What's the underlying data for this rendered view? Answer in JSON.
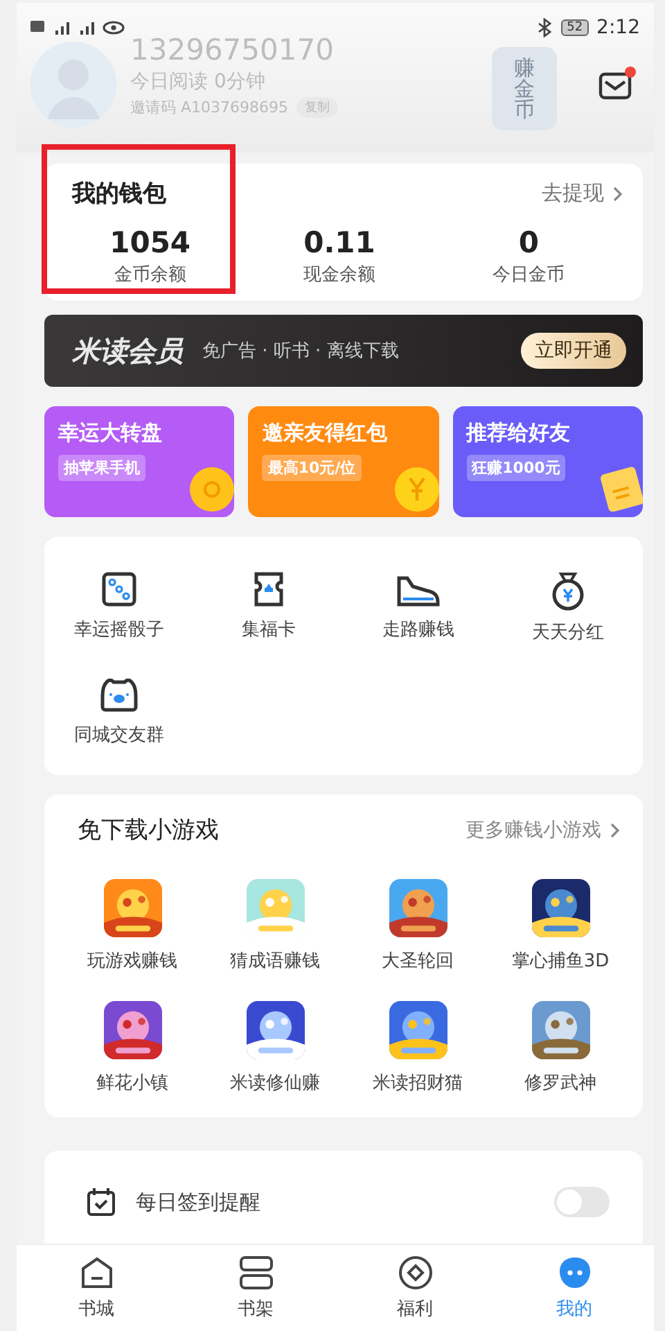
{
  "status_bar": {
    "time": "2:12",
    "battery": "52"
  },
  "profile": {
    "phone": "13296750170",
    "reading": "今日阅读 0分钟",
    "invite_code": "邀请码 A1037698695",
    "copy_button": "复制",
    "badge": "赚金币",
    "has_unread_mail": true
  },
  "wallet": {
    "title": "我的钱包",
    "action": "去提现",
    "highlighted": true,
    "stats": [
      {
        "value": "1054",
        "label": "金币余额"
      },
      {
        "value": "0.11",
        "label": "现金余额"
      },
      {
        "value": "0",
        "label": "今日金币"
      }
    ]
  },
  "vip_banner": {
    "title": "米读会员",
    "subtitle": "免广告 · 听书 · 离线下载",
    "button": "立即开通"
  },
  "promos": [
    {
      "kind": "wheel",
      "title": "幸运大转盘",
      "tag": "抽苹果手机",
      "color": "#b45cf5"
    },
    {
      "kind": "coin",
      "title": "邀亲友得红包",
      "tag": "最高10元/位",
      "color": "#ff8a10"
    },
    {
      "kind": "envelope",
      "title": "推荐给好友",
      "tag": "狂赚1000元",
      "color": "#6a5cf8"
    }
  ],
  "tools": [
    {
      "kind": "dice",
      "label": "幸运摇骰子"
    },
    {
      "kind": "card",
      "label": "集福卡"
    },
    {
      "kind": "shoe",
      "label": "走路赚钱"
    },
    {
      "kind": "bag",
      "label": "天天分红"
    },
    {
      "kind": "bear",
      "label": "同城交友群"
    }
  ],
  "games": {
    "title": "免下载小游戏",
    "more": "更多赚钱小游戏",
    "items": [
      {
        "label": "玩游戏赚钱",
        "kind": "picture"
      },
      {
        "label": "猜成语赚钱",
        "kind": "picture"
      },
      {
        "label": "大圣轮回",
        "kind": "picture"
      },
      {
        "label": "掌心捕鱼3D",
        "kind": "picture"
      },
      {
        "label": "鲜花小镇",
        "kind": "picture"
      },
      {
        "label": "米读修仙赚",
        "kind": "picture"
      },
      {
        "label": "米读招财猫",
        "kind": "picture"
      },
      {
        "label": "修罗武神",
        "kind": "picture"
      }
    ]
  },
  "sign_in_reminder": {
    "label": "每日签到提醒",
    "on": false
  },
  "tabs": [
    {
      "kind": "home",
      "label": "书城",
      "selected": false
    },
    {
      "kind": "shelf",
      "label": "书架",
      "selected": false
    },
    {
      "kind": "welfare",
      "label": "福利",
      "selected": false
    },
    {
      "kind": "me",
      "label": "我的",
      "selected": true
    }
  ]
}
